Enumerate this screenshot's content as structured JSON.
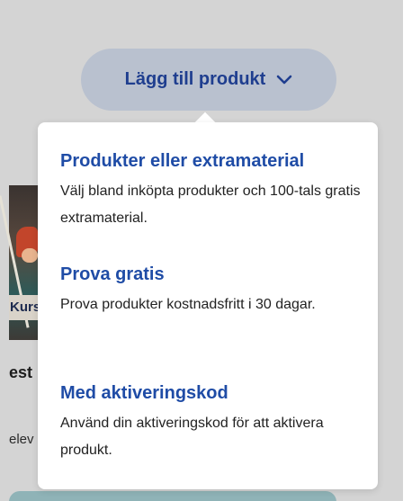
{
  "background": {
    "card_label": "Kurs",
    "card_title": "est",
    "card_subtitle": "elev",
    "colors": {
      "page_bg": "#d4d4d4",
      "bottom_bar": "#8fb3b7"
    }
  },
  "add_product_button": {
    "label": "Lägg till produkt",
    "icon": "chevron-down-icon",
    "colors": {
      "bg": "#b9c1cf",
      "text": "#1f3e8f"
    }
  },
  "menu": {
    "options": [
      {
        "title": "Produkter eller extramaterial",
        "description": "Välj bland inköpta produkter och 100-tals gratis extramaterial."
      },
      {
        "title": "Prova gratis",
        "description": "Prova produkter kostnadsfritt i 30 dagar."
      },
      {
        "title": "Med aktiveringskod",
        "description": "Använd din aktiveringskod för att aktivera produkt."
      }
    ],
    "colors": {
      "title": "#1f4ca6",
      "text": "#222222",
      "bg": "#ffffff"
    }
  }
}
